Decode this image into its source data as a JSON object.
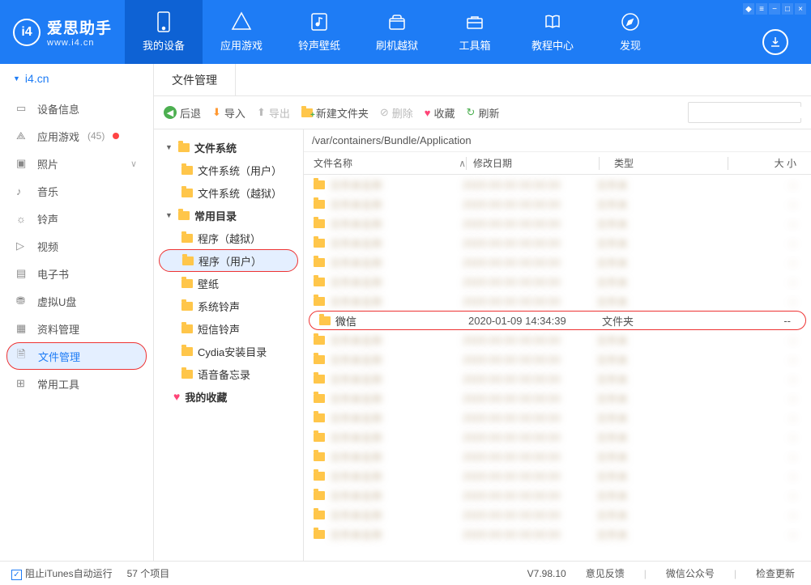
{
  "app": {
    "title": "爱思助手",
    "subtitle": "www.i4.cn"
  },
  "topnav": [
    {
      "label": "我的设备"
    },
    {
      "label": "应用游戏"
    },
    {
      "label": "铃声壁纸"
    },
    {
      "label": "刷机越狱"
    },
    {
      "label": "工具箱"
    },
    {
      "label": "教程中心"
    },
    {
      "label": "发现"
    }
  ],
  "device": {
    "name": "i4.cn"
  },
  "sidebar": [
    {
      "label": "设备信息",
      "icon": "info"
    },
    {
      "label": "应用游戏",
      "icon": "apps",
      "badge": "(45)",
      "dot": true
    },
    {
      "label": "照片",
      "icon": "photo",
      "chevron": true
    },
    {
      "label": "音乐",
      "icon": "music"
    },
    {
      "label": "铃声",
      "icon": "ring"
    },
    {
      "label": "视频",
      "icon": "video"
    },
    {
      "label": "电子书",
      "icon": "book"
    },
    {
      "label": "虚拟U盘",
      "icon": "usb"
    },
    {
      "label": "资料管理",
      "icon": "data"
    },
    {
      "label": "文件管理",
      "icon": "file",
      "selected": true
    },
    {
      "label": "常用工具",
      "icon": "tools"
    }
  ],
  "tab": {
    "label": "文件管理"
  },
  "toolbar": {
    "back": "后退",
    "import": "导入",
    "export": "导出",
    "newfolder": "新建文件夹",
    "delete": "删除",
    "fav": "收藏",
    "refresh": "刷新"
  },
  "tree": {
    "group1": "文件系统",
    "group1_items": [
      "文件系统（用户）",
      "文件系统（越狱）"
    ],
    "group2": "常用目录",
    "group2_items": [
      "程序（越狱）",
      "程序（用户）",
      "壁纸",
      "系统铃声",
      "短信铃声",
      "Cydia安装目录",
      "语音备忘录"
    ],
    "fav": "我的收藏"
  },
  "path": "/var/containers/Bundle/Application",
  "columns": {
    "name": "文件名称",
    "date": "修改日期",
    "type": "类型",
    "size": "大 小"
  },
  "highlight_row": {
    "name": "微信",
    "date": "2020-01-09 14:34:39",
    "type": "文件夹",
    "size": "--"
  },
  "footer": {
    "itunes": "阻止iTunes自动运行",
    "count": "57 个项目",
    "version": "V7.98.10",
    "links": [
      "意见反馈",
      "微信公众号",
      "检查更新"
    ]
  }
}
